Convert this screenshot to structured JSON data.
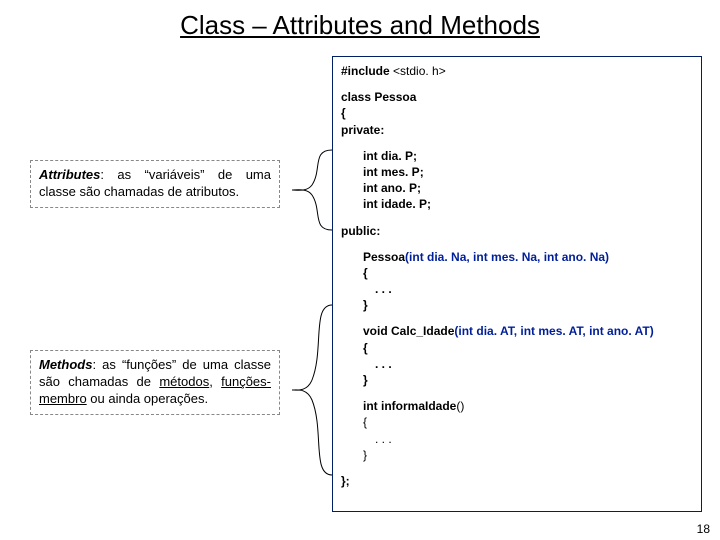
{
  "title": "Class – Attributes and Methods",
  "note1": {
    "lead": "Attributes",
    "rest": ": as “variáveis” de uma classe são chamadas de atributos."
  },
  "note2": {
    "lead": "Methods",
    "rest_prefix": ": as “funções” de uma classe são chamadas de ",
    "u1": "métodos",
    "sep1": ", ",
    "u2": "funções-membro",
    "rest_suffix": " ou ainda operações."
  },
  "code": {
    "include_pre": "#include ",
    "include_hdr": "<stdio. h>",
    "class_kw": "class ",
    "class_name": "Pessoa",
    "brace_open": "{",
    "private": "private:",
    "attr1_t": "int ",
    "attr1_n": "dia. P;",
    "attr2_t": "int ",
    "attr2_n": "mes. P;",
    "attr3_t": "int ",
    "attr3_n": "ano. P;",
    "attr4_t": "int ",
    "attr4_n": "idade. P;",
    "public": "public:",
    "ctor_name": "Pessoa",
    "ctor_sig": "(int dia. Na, int mes. Na, int ano. Na)",
    "body_open": "{",
    "ellipsis": ". . .",
    "body_close": "}",
    "m1_ret": "void ",
    "m1_name": "Calc_Idade",
    "m1_sig": "(int dia. AT, int mes. AT, int ano. AT)",
    "m2_ret": "int ",
    "m2_name": "informaIdade",
    "m2_sig": "()",
    "class_close": "};"
  },
  "pagenum": "18"
}
